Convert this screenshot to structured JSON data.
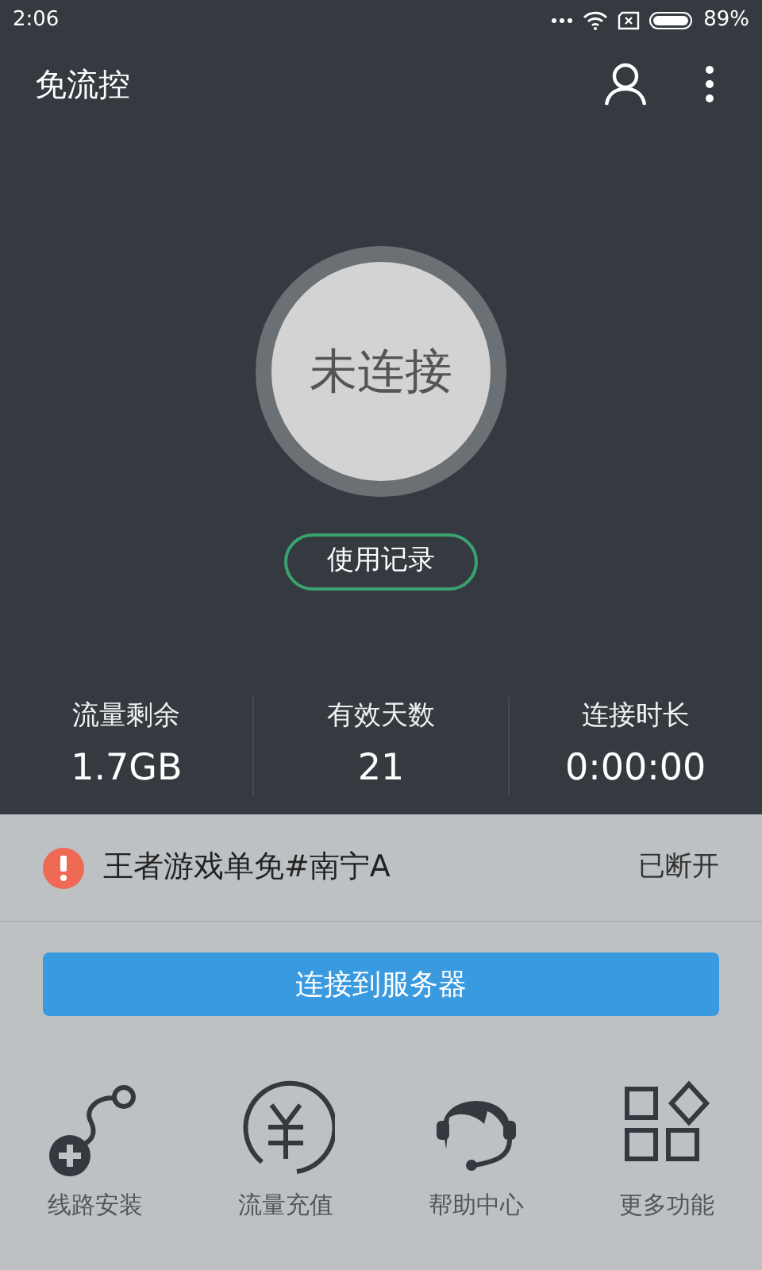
{
  "status_bar": {
    "time": "2:06",
    "battery": "89%"
  },
  "app_bar": {
    "title": "免流控"
  },
  "connection": {
    "status": "未连接",
    "connected": false
  },
  "history_button": "使用记录",
  "stats": [
    {
      "label": "流量剩余",
      "value": "1.7GB"
    },
    {
      "label": "有效天数",
      "value": "21"
    },
    {
      "label": "连接时长",
      "value": "0:00:00"
    }
  ],
  "server": {
    "name": "王者游戏单免#南宁A",
    "state": "已断开",
    "connected": false
  },
  "connect_button": "连接到服务器",
  "shortcuts": [
    {
      "label": "线路安装"
    },
    {
      "label": "流量充值"
    },
    {
      "label": "帮助中心"
    },
    {
      "label": "更多功能"
    }
  ]
}
